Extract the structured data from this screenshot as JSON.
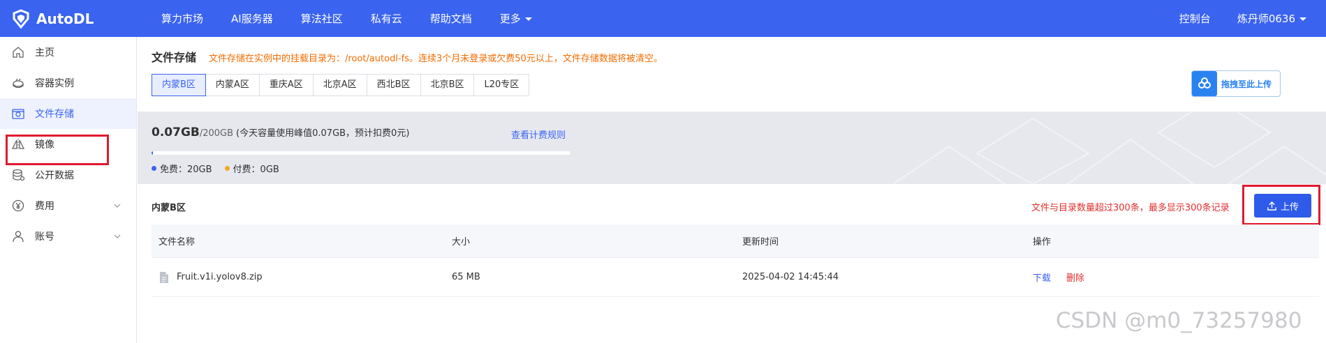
{
  "brand": {
    "name": "AutoDL"
  },
  "topnav": {
    "items": [
      "算力市场",
      "AI服务器",
      "算法社区",
      "私有云",
      "帮助文档"
    ],
    "more": "更多",
    "console": "控制台",
    "user": "炼丹师0636"
  },
  "sidebar": {
    "items": [
      {
        "label": "主页",
        "icon": "home-icon"
      },
      {
        "label": "容器实例",
        "icon": "container-icon"
      },
      {
        "label": "文件存储",
        "icon": "folder-storage-icon"
      },
      {
        "label": "镜像",
        "icon": "mirror-icon"
      },
      {
        "label": "公开数据",
        "icon": "database-icon"
      },
      {
        "label": "费用",
        "icon": "yen-icon"
      },
      {
        "label": "账号",
        "icon": "user-icon"
      }
    ]
  },
  "storage": {
    "title": "文件存储",
    "notice": "文件存储在实例中的挂载目录为：/root/autodl-fs。连续3个月未登录或欠费50元以上，文件存储数据将被清空。",
    "regions": [
      "内蒙B区",
      "内蒙A区",
      "重庆A区",
      "北京A区",
      "西北B区",
      "北京B区",
      "L20专区"
    ],
    "active_region": "内蒙B区",
    "drag_upload": "拖拽至此上传",
    "used": "0.07GB",
    "total": "/200GB",
    "usage_note": "(今天容量使用峰值0.07GB，预计扣费0元)",
    "billing_link": "查看计费规则",
    "usage_fraction": 0.00035,
    "free": "免费：20GB",
    "paid": "付费：0GB",
    "colors": {
      "accent": "#3a63f0",
      "free_dot": "#3a63f0",
      "paid_dot": "#f5a623"
    }
  },
  "files": {
    "region_label": "内蒙B区",
    "warning": "文件与目录数量超过300条，最多显示300条记录",
    "upload": "上传",
    "headers": [
      "文件名称",
      "大小",
      "更新时间",
      "操作"
    ],
    "rows": [
      {
        "name": "Fruit.v1i.yolov8.zip",
        "size": "65 MB",
        "updated": "2025-04-02 14:45:44",
        "download": "下载",
        "delete": "删除"
      }
    ]
  },
  "watermark": "CSDN @m0_73257980"
}
